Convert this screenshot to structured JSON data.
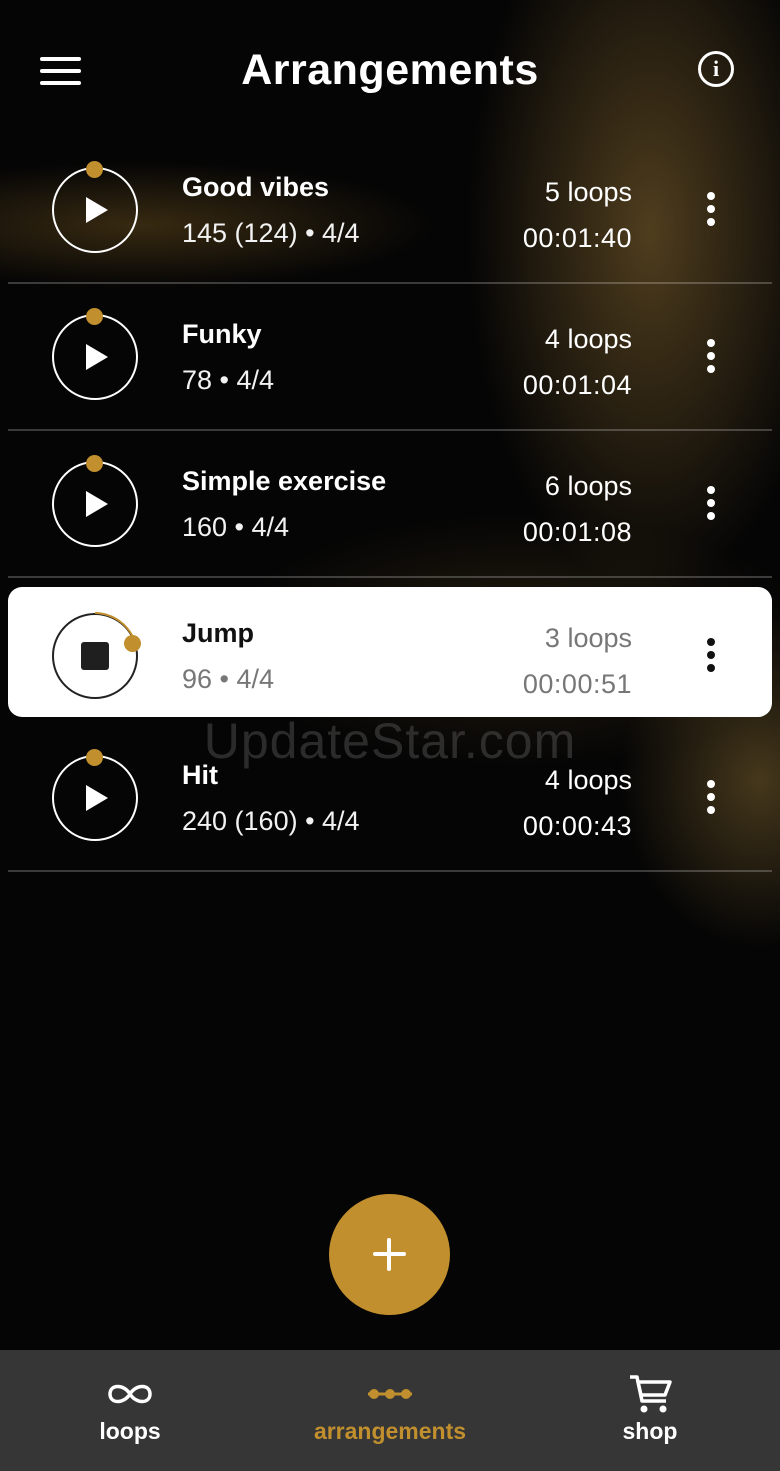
{
  "header": {
    "title": "Arrangements"
  },
  "arrangements": [
    {
      "name": "Good vibes",
      "meta": "145 (124) • 4/4",
      "loops": "5 loops",
      "duration": "00:01:40",
      "playing": false
    },
    {
      "name": "Funky",
      "meta": "78 • 4/4",
      "loops": "4 loops",
      "duration": "00:01:04",
      "playing": false
    },
    {
      "name": "Simple exercise",
      "meta": "160 • 4/4",
      "loops": "6 loops",
      "duration": "00:01:08",
      "playing": false
    },
    {
      "name": "Jump",
      "meta": "96 • 4/4",
      "loops": "3 loops",
      "duration": "00:00:51",
      "playing": true
    },
    {
      "name": "Hit",
      "meta": "240 (160) • 4/4",
      "loops": "4 loops",
      "duration": "00:00:43",
      "playing": false
    }
  ],
  "watermark": "UpdateStar.com",
  "bottom_nav": [
    {
      "label": "loops",
      "icon": "infinity-icon",
      "selected": false
    },
    {
      "label": "arrangements",
      "icon": "arrangement-chain-icon",
      "selected": true
    },
    {
      "label": "shop",
      "icon": "cart-icon",
      "selected": false
    }
  ],
  "colors": {
    "accent": "#c18f2d",
    "background": "#050505",
    "nav_bg": "#363636"
  }
}
